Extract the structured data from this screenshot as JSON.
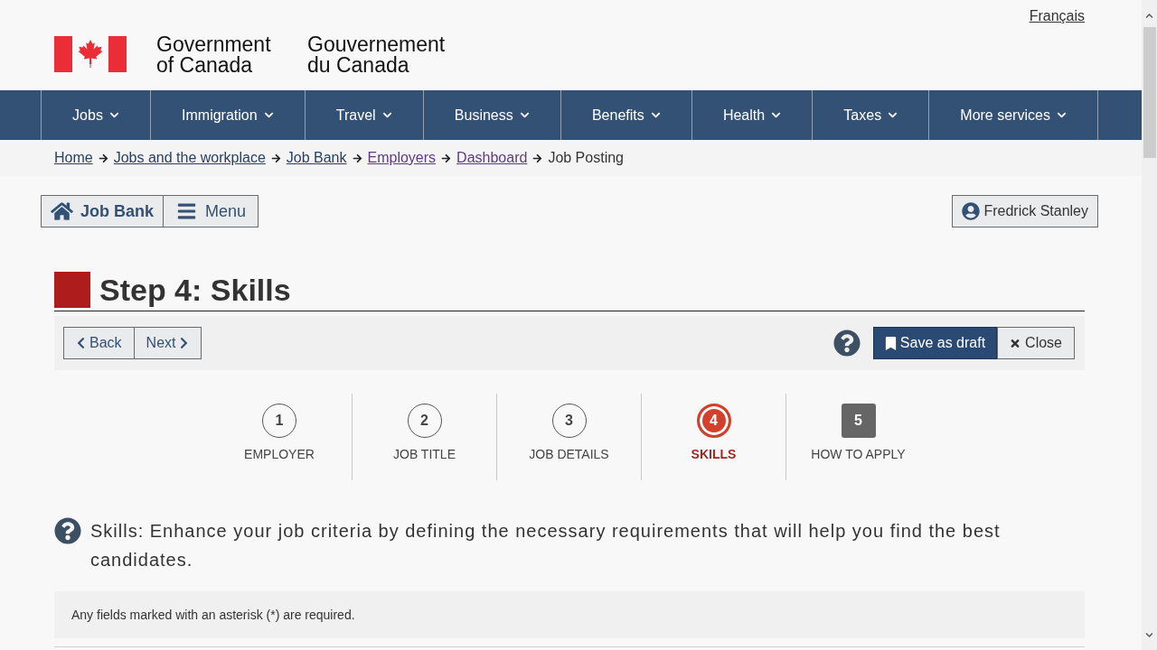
{
  "header": {
    "language_link": "Français",
    "signature": {
      "english": "Government of Canada",
      "french": "Gouvernement du Canada"
    }
  },
  "nav": [
    "Jobs",
    "Immigration",
    "Travel",
    "Business",
    "Benefits",
    "Health",
    "Taxes",
    "More services"
  ],
  "breadcrumbs": [
    {
      "label": "Home",
      "kind": "link",
      "visited": false
    },
    {
      "label": "Jobs and the workplace",
      "kind": "link",
      "visited": false
    },
    {
      "label": "Job Bank",
      "kind": "link",
      "visited": false
    },
    {
      "label": "Employers",
      "kind": "link",
      "visited": true
    },
    {
      "label": "Dashboard",
      "kind": "link",
      "visited": true
    },
    {
      "label": "Job Posting",
      "kind": "text"
    }
  ],
  "app_bar": {
    "home_button": "Job Bank",
    "menu_button": "Menu",
    "user_button": "Fredrick Stanley"
  },
  "page_title": "Step 4: Skills",
  "toolbar": {
    "back": "Back",
    "next": "Next",
    "save": "Save as draft",
    "close": "Close"
  },
  "steps": [
    {
      "number": "1",
      "label": "EMPLOYER",
      "selected": false,
      "locked": false
    },
    {
      "number": "2",
      "label": "JOB TITLE",
      "selected": false,
      "locked": false
    },
    {
      "number": "3",
      "label": "JOB DETAILS",
      "selected": false,
      "locked": false
    },
    {
      "number": "4",
      "label": "SKILLS",
      "selected": true,
      "locked": false
    },
    {
      "number": "5",
      "label": "HOW TO APPLY",
      "selected": false,
      "locked": true
    }
  ],
  "intro": "Skills: Enhance your job criteria by defining the necessary requirements that will help you find the best candidates.",
  "notice": "Any fields marked with an asterisk (*) are required."
}
